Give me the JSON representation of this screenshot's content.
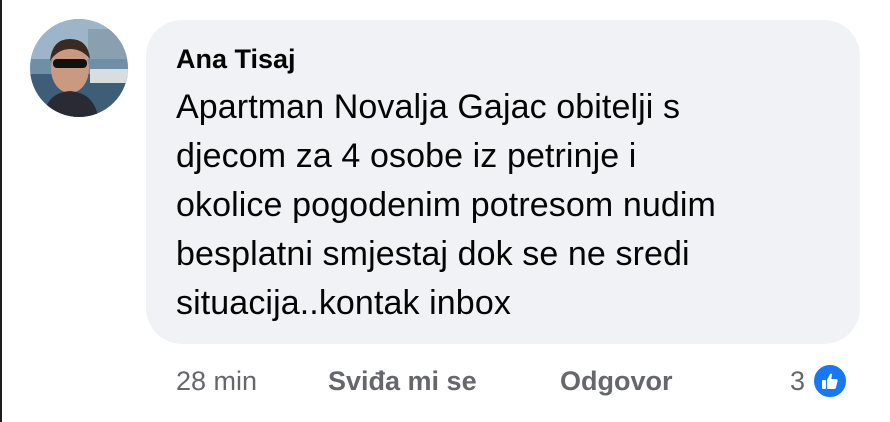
{
  "comment": {
    "author": "Ana Tisaj",
    "text": "Apartman Novalja Gajac obitelji s\ndjecom za 4 osobe iz petrinje i\nokolice pogodenim potresom nudim\nbesplatni smjestaj dok se ne sredi\nsituacija..kontak inbox",
    "avatar_icon": "profile-photo"
  },
  "actions": {
    "timestamp": "28 min",
    "like_label": "Sviđa mi se",
    "reply_label": "Odgovor"
  },
  "reactions": {
    "count": "3",
    "icon": "thumbs-up-icon",
    "color": "#1877f2"
  },
  "colors": {
    "bubble": "#f0f2f5",
    "secondary_text": "#65676b",
    "primary_text": "#050505"
  }
}
